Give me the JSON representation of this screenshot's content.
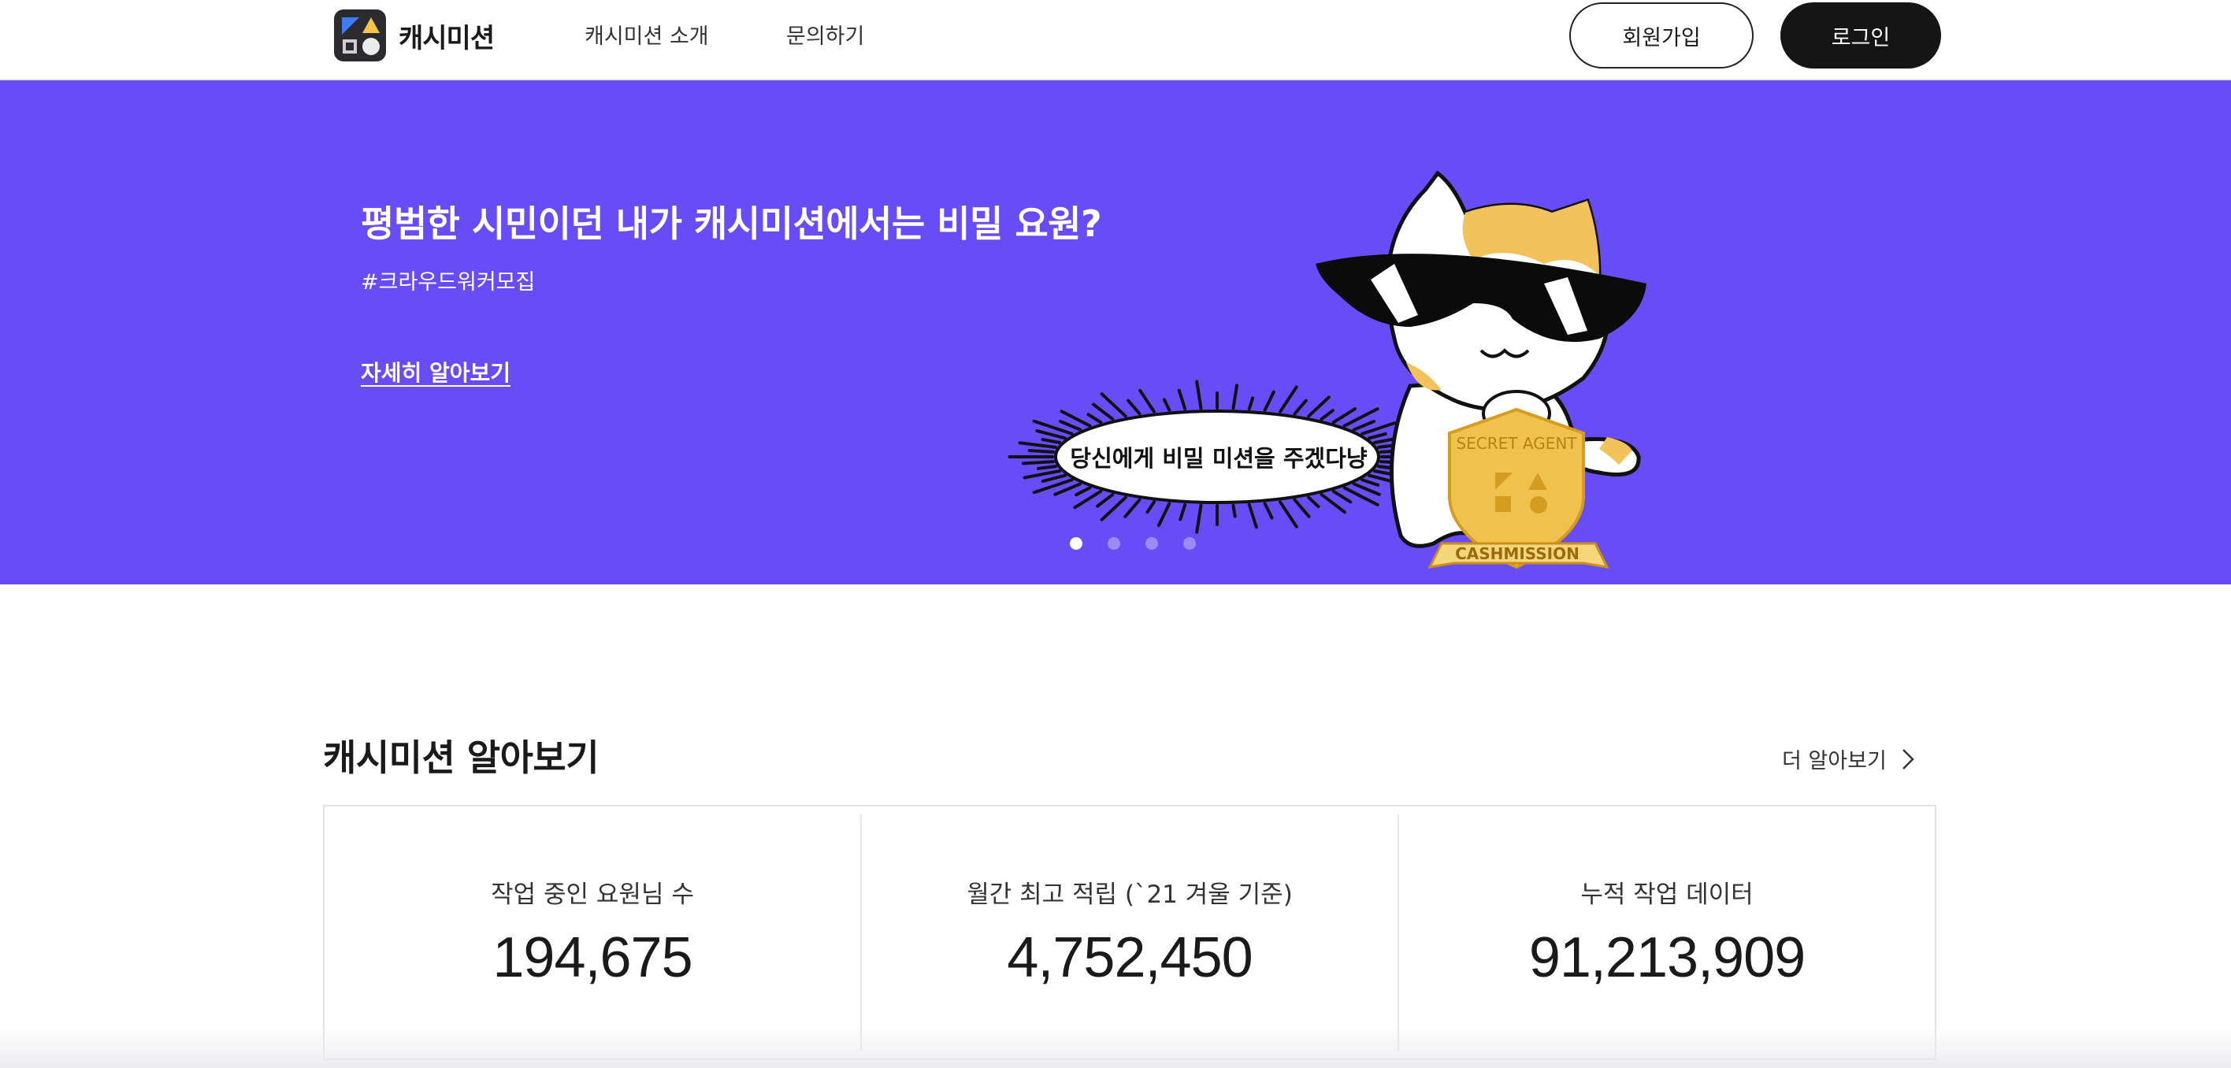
{
  "brand": {
    "name": "캐시미션"
  },
  "nav": {
    "about": "캐시미션 소개",
    "contact": "문의하기"
  },
  "auth": {
    "signup": "회원가입",
    "login": "로그인"
  },
  "hero": {
    "title": "평범한 시민이던 내가 캐시미션에서는 비밀 요원?",
    "tag": "#크라우드워커모집",
    "more": "자세히 알아보기",
    "bubble": "당신에게 비밀 미션을 주겠다냥",
    "badge_top": "SECRET AGENT",
    "badge_ribbon": "CASHMISSION",
    "bg_color": "#684cf5",
    "slides_total": 4,
    "slide_active": 1
  },
  "stats_section": {
    "title": "캐시미션 알아보기",
    "more": "더 알아보기",
    "items": [
      {
        "label": "작업 중인 요원님 수",
        "value": "194,675"
      },
      {
        "label": "월간 최고 적립 (`21 겨울 기준)",
        "value": "4,752,450"
      },
      {
        "label": "누적 작업 데이터",
        "value": "91,213,909"
      }
    ]
  }
}
